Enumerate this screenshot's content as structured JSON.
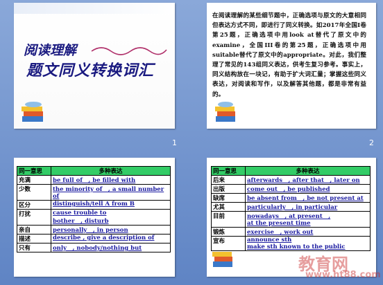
{
  "slide1": {
    "number": "1",
    "title_line1": "阅读理解",
    "title_line2": "题文同义转换词汇"
  },
  "slide2": {
    "number": "2",
    "paragraph": "在阅读理解的某些细节题中，正确选项与原文的大意相同但表达方式不同，即进行了同义转换。如2017年全国I卷第25题，正确选项中用look at替代了原文中的examine，全国III卷的第25题，正确选项中用suitable替代了原文中的appropriate。对此，我们整理了常见的143组同义表达，供考生复习参考。事实上，同义结构放在一块记，有助于扩大词汇量；掌握这些同义表达，对阅读和写作，以及解答其他题，都是非常有益的。"
  },
  "slide3": {
    "header_col1": "同一意思",
    "header_col2": "多种表达",
    "rows": [
      {
        "meaning": "充满",
        "expressions": [
          "be full of　, be filled with"
        ]
      },
      {
        "meaning": "少数",
        "expressions": [
          "the minority of　, a small number of"
        ]
      },
      {
        "meaning": "区分",
        "expressions": [
          "distinguish/tell A from B"
        ]
      },
      {
        "meaning": "打扰",
        "expressions": [
          "cause trouble to",
          "bother　, disturb"
        ]
      },
      {
        "meaning": "亲自",
        "expressions": [
          "personally　, in person"
        ]
      },
      {
        "meaning": "描述",
        "expressions": [
          "describe , give a description of"
        ]
      },
      {
        "meaning": "只有",
        "expressions": [
          "only　, nobody/nothing but"
        ]
      }
    ]
  },
  "slide4": {
    "header_col1": "同一意思",
    "header_col2": "多种表达",
    "rows": [
      {
        "meaning": "后来",
        "expressions": [
          "afterwards　, after that　, later on"
        ]
      },
      {
        "meaning": "出版",
        "expressions": [
          "come out　, be published"
        ]
      },
      {
        "meaning": "缺席",
        "expressions": [
          "be absent from　, be not present at"
        ]
      },
      {
        "meaning": "尤其",
        "expressions": [
          "particularly　, in particular"
        ]
      },
      {
        "meaning": "目前",
        "expressions": [
          "nowadays　, at present　,",
          "at the present time"
        ]
      },
      {
        "meaning": "锻炼",
        "expressions": [
          "exercise　, work out"
        ]
      },
      {
        "meaning": "宣布",
        "expressions": [
          "announce sth",
          "make sth known to the public"
        ]
      }
    ]
  },
  "watermark": {
    "brand": "教育网",
    "url": "www.ht88.com"
  },
  "colors": {
    "background": "#7f9fd3",
    "table_header": "#33cc66",
    "expression_text": "#1a1aa0",
    "title_text": "#1a1a80"
  }
}
